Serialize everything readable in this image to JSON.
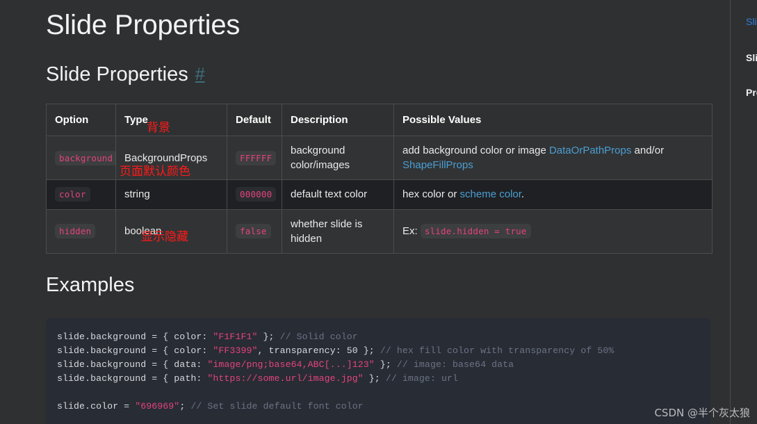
{
  "page": {
    "title": "Slide Properties",
    "section_heading": "Slide Properties",
    "anchor_symbol": "#",
    "examples_heading": "Examples"
  },
  "table": {
    "headers": [
      "Option",
      "Type",
      "Default",
      "Description",
      "Possible Values"
    ],
    "rows": [
      {
        "option": "background",
        "type": "BackgroundProps",
        "type_annotation": "背景",
        "default": "FFFFFF",
        "description": "background color/images",
        "possible_values_text_1": "add background color or image ",
        "possible_values_link_1": "DataOrPathProps",
        "possible_values_text_2": " and/or ",
        "possible_values_link_2": "ShapeFillProps",
        "possible_values_text_3": ""
      },
      {
        "option": "color",
        "type": "string",
        "type_annotation": "页面默认颜色",
        "default": "000000",
        "description": "default text color",
        "possible_values_text_1": "hex color or ",
        "possible_values_link_1": "scheme color",
        "possible_values_text_2": ".",
        "possible_values_link_2": "",
        "possible_values_text_3": ""
      },
      {
        "option": "hidden",
        "type": "boolean",
        "type_annotation": "显示隐藏",
        "default": "false",
        "description": "whether slide is hidden",
        "possible_values_text_1": "Ex: ",
        "possible_values_code": "slide.hidden = true"
      }
    ]
  },
  "code_example": {
    "lines": [
      [
        {
          "t": "slide.background = { color: ",
          "c": "plain"
        },
        {
          "t": "\"F1F1F1\"",
          "c": "str"
        },
        {
          "t": " }; ",
          "c": "plain"
        },
        {
          "t": "// Solid color",
          "c": "comment"
        }
      ],
      [
        {
          "t": "slide.background = { color: ",
          "c": "plain"
        },
        {
          "t": "\"FF3399\"",
          "c": "str"
        },
        {
          "t": ", transparency: ",
          "c": "plain"
        },
        {
          "t": "50",
          "c": "plain"
        },
        {
          "t": " }; ",
          "c": "plain"
        },
        {
          "t": "// hex fill color with transparency of 50%",
          "c": "comment"
        }
      ],
      [
        {
          "t": "slide.background = { data: ",
          "c": "plain"
        },
        {
          "t": "\"image/png;base64,ABC[...]123\"",
          "c": "str"
        },
        {
          "t": " }; ",
          "c": "plain"
        },
        {
          "t": "// image: base64 data",
          "c": "comment"
        }
      ],
      [
        {
          "t": "slide.background = { path: ",
          "c": "plain"
        },
        {
          "t": "\"https://some.url/image.jpg\"",
          "c": "str"
        },
        {
          "t": " }; ",
          "c": "plain"
        },
        {
          "t": "// image: url",
          "c": "comment"
        }
      ],
      [],
      [
        {
          "t": "slide.color = ",
          "c": "plain"
        },
        {
          "t": "\"696969\"",
          "c": "str"
        },
        {
          "t": "; ",
          "c": "plain"
        },
        {
          "t": "// Set slide default font color",
          "c": "comment"
        }
      ]
    ]
  },
  "toc": {
    "items": [
      {
        "label": "Slide Properties",
        "active": true
      },
      {
        "label": "Slide Properties",
        "active": false
      },
      {
        "label": "Properties",
        "active": false
      }
    ]
  },
  "watermark": {
    "text": "CSDN @半个灰太狼"
  },
  "colors": {
    "background": "#2f3031",
    "row_odd": "#323334",
    "row_even": "#1f2023",
    "border": "#4b4c4d",
    "link": "#4a9fd4",
    "code_chip_text": "#e3447c",
    "annotation_red": "#ff1a1a",
    "code_block_bg": "#282c34",
    "toc_active": "#2f7fe0"
  }
}
